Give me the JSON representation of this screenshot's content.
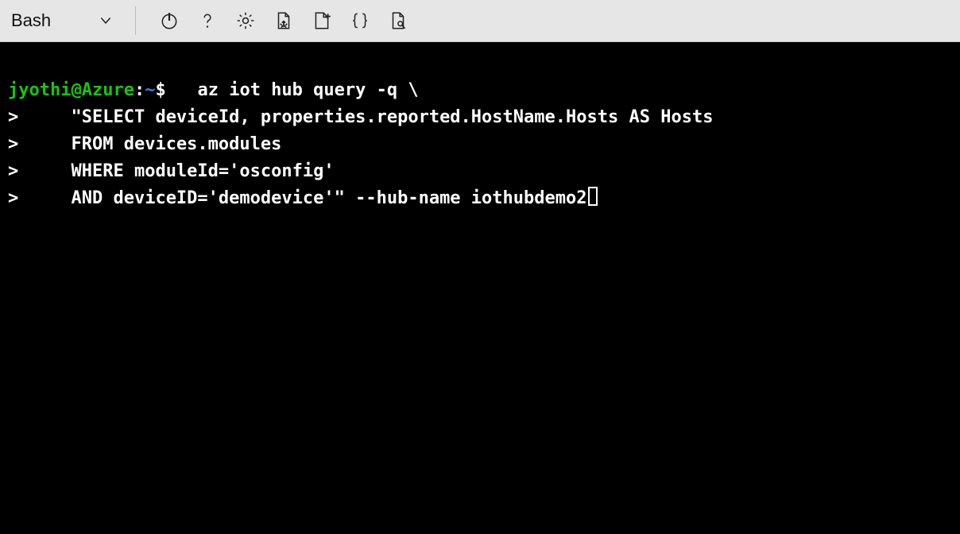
{
  "toolbar": {
    "shell_label": "Bash",
    "icons": {
      "power": "power-icon",
      "help": "help-icon",
      "settings": "gear-icon",
      "download": "download-file-icon",
      "upload": "upload-file-icon",
      "braces": "braces-icon",
      "preview": "file-search-icon"
    }
  },
  "terminal": {
    "user": "jyothi",
    "host": "Azure",
    "path": "~",
    "prompt_symbol": "$",
    "continuation_prompt": ">",
    "lines": {
      "l0": "az iot hub query -q \\",
      "l1": "\"SELECT deviceId, properties.reported.HostName.Hosts AS Hosts",
      "l2": "FROM devices.modules",
      "l3": "WHERE moduleId='osconfig'",
      "l4": "AND deviceID='demodevice'\" --hub-name iothubdemo2"
    }
  }
}
